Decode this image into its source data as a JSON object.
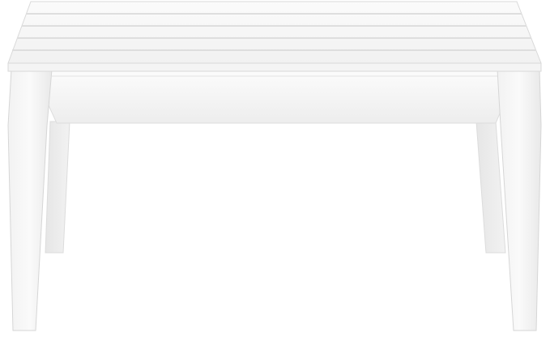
{
  "image": {
    "subject": "white-table",
    "background_color": "#ffffff",
    "furniture_color": "#f7f7f7",
    "shadow_color": "#e2e2e2",
    "outline_color": "#d8d8d8",
    "slat_count": 5
  }
}
